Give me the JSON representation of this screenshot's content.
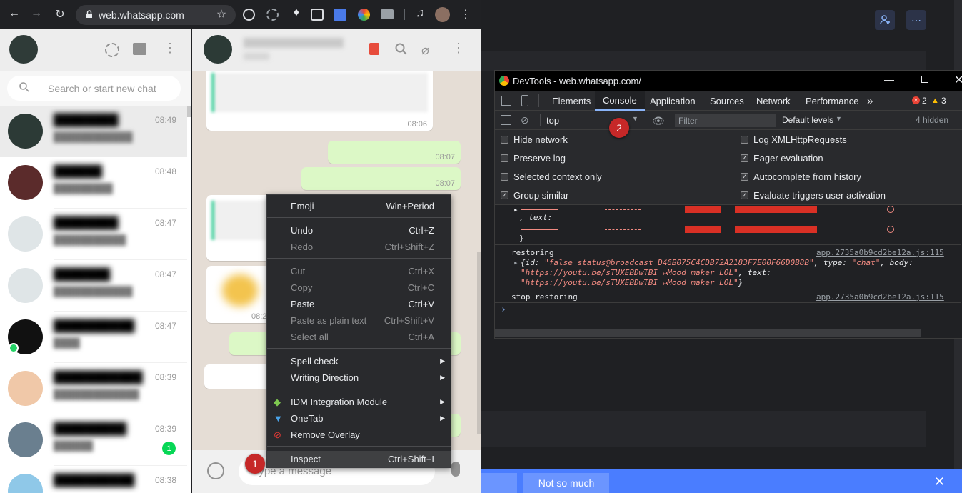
{
  "browser": {
    "url": "web.whatsapp.com"
  },
  "sidebar": {
    "search_placeholder": "Search or start new chat",
    "chats": [
      {
        "time": "08:49",
        "avatar_color": "#2c3a36"
      },
      {
        "time": "08:48",
        "avatar_color": "#5b2b2b"
      },
      {
        "time": "08:47",
        "avatar_color": "#dfe5e7"
      },
      {
        "time": "08:47",
        "avatar_color": "#dfe5e7"
      },
      {
        "time": "08:47",
        "avatar_color": "#111111"
      },
      {
        "time": "08:39",
        "avatar_color": "#f0c8a8"
      },
      {
        "time": "08:39",
        "avatar_color": "#6a7f8f",
        "unread": "1"
      },
      {
        "time": "08:38",
        "avatar_color": "#8fc8e8"
      }
    ]
  },
  "conversation": {
    "times": [
      "08:06",
      "08:07",
      "08:07",
      "08:2"
    ],
    "input_placeholder": "Type a message"
  },
  "context_menu": {
    "items": [
      {
        "label": "Emoji",
        "shortcut": "Win+Period"
      },
      {
        "label": "Undo",
        "shortcut": "Ctrl+Z"
      },
      {
        "label": "Redo",
        "shortcut": "Ctrl+Shift+Z"
      },
      {
        "label": "Cut",
        "shortcut": "Ctrl+X"
      },
      {
        "label": "Copy",
        "shortcut": "Ctrl+C"
      },
      {
        "label": "Paste",
        "shortcut": "Ctrl+V"
      },
      {
        "label": "Paste as plain text",
        "shortcut": "Ctrl+Shift+V"
      },
      {
        "label": "Select all",
        "shortcut": "Ctrl+A"
      },
      {
        "label": "Spell check"
      },
      {
        "label": "Writing Direction"
      },
      {
        "label": "IDM Integration Module"
      },
      {
        "label": "OneTab"
      },
      {
        "label": "Remove Overlay"
      },
      {
        "label": "Inspect",
        "shortcut": "Ctrl+Shift+I"
      }
    ]
  },
  "devtools": {
    "title": "DevTools - web.whatsapp.com/",
    "tabs": [
      "Elements",
      "Console",
      "Application",
      "Sources",
      "Network",
      "Performance"
    ],
    "active_tab": "Console",
    "errors": "2",
    "warnings": "3",
    "context": "top",
    "filter_placeholder": "Filter",
    "levels": "Default levels",
    "hidden": "4 hidden",
    "settings_left": [
      "Hide network",
      "Preserve log",
      "Selected context only",
      "Group similar"
    ],
    "settings_left_checked": [
      false,
      false,
      false,
      true
    ],
    "settings_right": [
      "Log XMLHttpRequests",
      "Eager evaluation",
      "Autocomplete from history",
      "Evaluate triggers user activation"
    ],
    "settings_right_checked": [
      false,
      true,
      true,
      true
    ],
    "console": {
      "text_label": ", text:",
      "close_brace": "}",
      "restoring": "restoring",
      "restoring_source": "app.2735a0b9cd2be12a.js:115",
      "obj_line1_a": "{id: ",
      "obj_id": "\"false_status@broadcast_D46B075C4CDB72A2183F7E00F66D0B8B\"",
      "obj_line1_b": ", type: ",
      "obj_type": "\"chat\"",
      "obj_line1_c": ", body:",
      "obj_body": "\"https://youtu.be/sTUXEBDwTBI ↵Mood maker LOL\"",
      "obj_line2_b": ", text:",
      "obj_text": "\"https://youtu.be/sTUXEBDwTBI ↵Mood maker LOL\"",
      "obj_line3_b": "}",
      "stop": "stop restoring",
      "stop_source": "app.2735a0b9cd2be12a.js:115",
      "prompt": "›"
    }
  },
  "annotations": [
    "1",
    "2"
  ],
  "feedback_bar": {
    "option": "Not so much"
  }
}
